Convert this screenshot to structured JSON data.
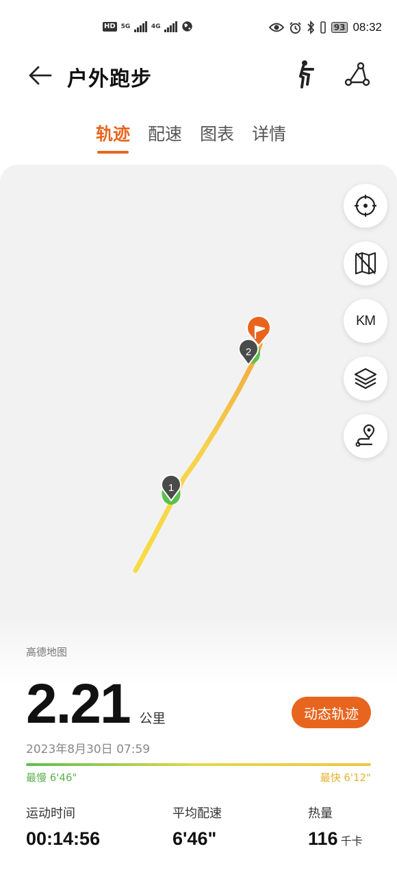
{
  "status_bar": {
    "hd_label": "HD",
    "net1": "5G",
    "net2": "4G",
    "battery": "93",
    "time": "08:32"
  },
  "header": {
    "title": "户外跑步"
  },
  "tabs": [
    {
      "label": "轨迹",
      "active": true
    },
    {
      "label": "配速",
      "active": false
    },
    {
      "label": "图表",
      "active": false
    },
    {
      "label": "详情",
      "active": false
    }
  ],
  "map": {
    "markers": [
      {
        "label": "1"
      },
      {
        "label": "2"
      }
    ],
    "controls": {
      "km_label": "KM"
    },
    "route_colors": {
      "slow": "#5cbf4e",
      "mid": "#f5d547",
      "fast": "#f2a83b"
    },
    "finish_color": "#e8651f"
  },
  "summary": {
    "map_provider": "高德地图",
    "distance": "2.21",
    "distance_unit": "公里",
    "replay_button": "动态轨迹",
    "datetime": "2023年8月30日 07:59",
    "pace_slowest": "最慢 6'46\"",
    "pace_fastest": "最快 6'12\""
  },
  "stats": [
    {
      "label": "运动时间",
      "value": "00:14:56",
      "unit": ""
    },
    {
      "label": "平均配速",
      "value": "6'46\"",
      "unit": ""
    },
    {
      "label": "热量",
      "value": "116",
      "unit": "千卡"
    }
  ],
  "colors": {
    "accent": "#e8651f"
  }
}
